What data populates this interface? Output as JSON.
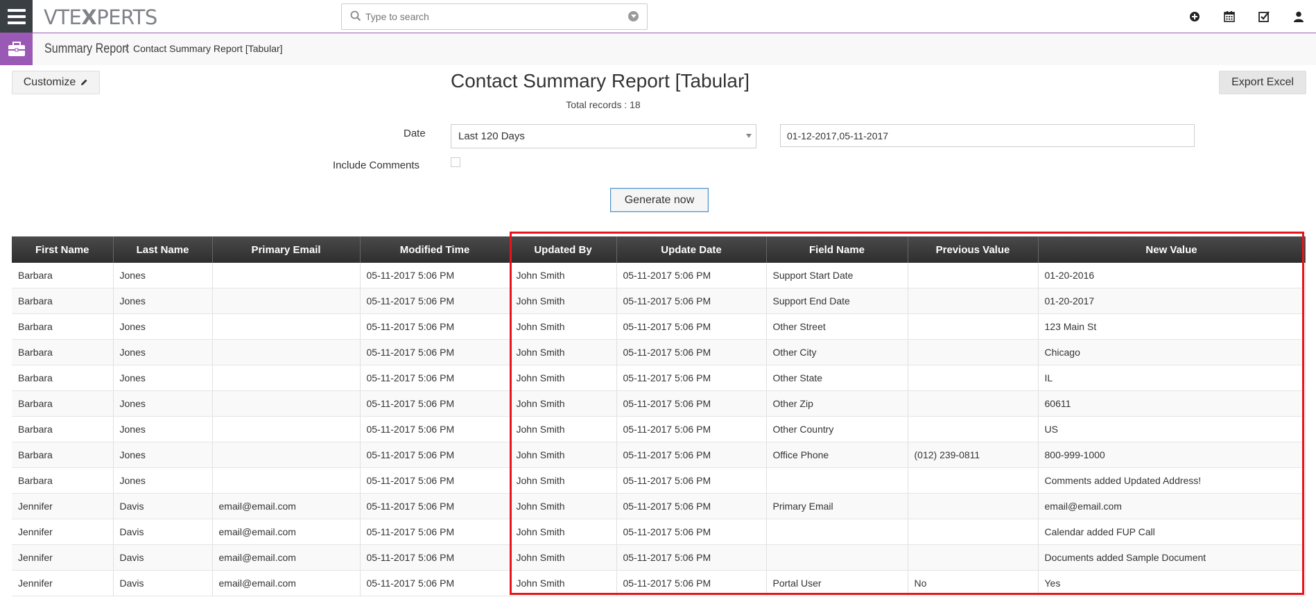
{
  "app": {
    "logo_light": "VTE",
    "logo_bold": "X",
    "logo_rest": "PERTS"
  },
  "search": {
    "placeholder": "Type to search"
  },
  "topbar_icons": [
    "add-icon",
    "calendar-icon",
    "task-check-icon",
    "user-icon"
  ],
  "breadcrumb": {
    "module": "Summary Report",
    "separator": "›",
    "current": "Contact Summary Report [Tabular]"
  },
  "toolbar": {
    "customize_label": "Customize",
    "export_label": "Export Excel",
    "generate_label": "Generate now"
  },
  "report": {
    "title": "Contact Summary Report [Tabular]",
    "total_records": "Total records : 18"
  },
  "filters": {
    "date_label": "Date",
    "date_selected": "Last 120 Days",
    "date_range": "01-12-2017,05-11-2017",
    "include_comments_label": "Include Comments",
    "include_comments_checked": false
  },
  "table": {
    "columns": [
      "First Name",
      "Last Name",
      "Primary Email",
      "Modified Time",
      "Updated By",
      "Update Date",
      "Field Name",
      "Previous Value",
      "New Value"
    ],
    "rows": [
      [
        "Barbara",
        "Jones",
        "",
        "05-11-2017 5:06 PM",
        "John Smith",
        "05-11-2017 5:06 PM",
        "Support Start Date",
        "",
        "01-20-2016"
      ],
      [
        "Barbara",
        "Jones",
        "",
        "05-11-2017 5:06 PM",
        "John Smith",
        "05-11-2017 5:06 PM",
        "Support End Date",
        "",
        "01-20-2017"
      ],
      [
        "Barbara",
        "Jones",
        "",
        "05-11-2017 5:06 PM",
        "John Smith",
        "05-11-2017 5:06 PM",
        "Other Street",
        "",
        "123 Main St"
      ],
      [
        "Barbara",
        "Jones",
        "",
        "05-11-2017 5:06 PM",
        "John Smith",
        "05-11-2017 5:06 PM",
        "Other City",
        "",
        "Chicago"
      ],
      [
        "Barbara",
        "Jones",
        "",
        "05-11-2017 5:06 PM",
        "John Smith",
        "05-11-2017 5:06 PM",
        "Other State",
        "",
        "IL"
      ],
      [
        "Barbara",
        "Jones",
        "",
        "05-11-2017 5:06 PM",
        "John Smith",
        "05-11-2017 5:06 PM",
        "Other Zip",
        "",
        "60611"
      ],
      [
        "Barbara",
        "Jones",
        "",
        "05-11-2017 5:06 PM",
        "John Smith",
        "05-11-2017 5:06 PM",
        "Other Country",
        "",
        "US"
      ],
      [
        "Barbara",
        "Jones",
        "",
        "05-11-2017 5:06 PM",
        "John Smith",
        "05-11-2017 5:06 PM",
        "Office Phone",
        "(012) 239-0811",
        "800-999-1000"
      ],
      [
        "Barbara",
        "Jones",
        "",
        "05-11-2017 5:06 PM",
        "John Smith",
        "05-11-2017 5:06 PM",
        "",
        "",
        "Comments added Updated Address!"
      ],
      [
        "Jennifer",
        "Davis",
        "email@email.com",
        "05-11-2017 5:06 PM",
        "John Smith",
        "05-11-2017 5:06 PM",
        "Primary Email",
        "",
        "email@email.com"
      ],
      [
        "Jennifer",
        "Davis",
        "email@email.com",
        "05-11-2017 5:06 PM",
        "John Smith",
        "05-11-2017 5:06 PM",
        "",
        "",
        "Calendar added  FUP Call"
      ],
      [
        "Jennifer",
        "Davis",
        "email@email.com",
        "05-11-2017 5:06 PM",
        "John Smith",
        "05-11-2017 5:06 PM",
        "",
        "",
        "Documents added Sample Document"
      ],
      [
        "Jennifer",
        "Davis",
        "email@email.com",
        "05-11-2017 5:06 PM",
        "John Smith",
        "05-11-2017 5:06 PM",
        "Portal User",
        "No",
        "Yes"
      ]
    ]
  },
  "colors": {
    "topbar_menu_bg": "#3a3f44",
    "module_accent": "#9b59b6",
    "table_header_bg": "#333333",
    "highlight_border": "#e8141b"
  }
}
